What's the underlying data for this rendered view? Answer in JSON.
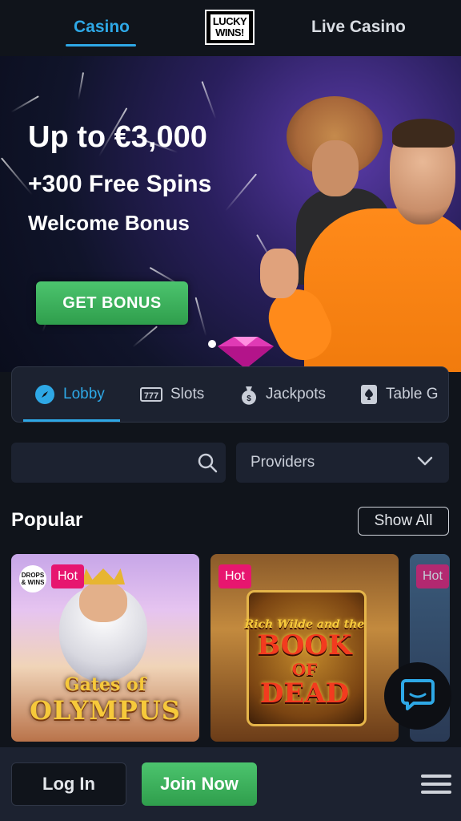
{
  "topnav": {
    "tab_casino": "Casino",
    "tab_live_casino": "Live Casino",
    "logo_line1": "LUCKY",
    "logo_line2": "WINS!"
  },
  "hero": {
    "headline": "Up to €3,000",
    "subline": "+300 Free Spins",
    "tagline": "Welcome Bonus",
    "cta_label": "GET BONUS"
  },
  "categories": [
    {
      "label": "Lobby",
      "icon": "compass-icon",
      "active": true
    },
    {
      "label": "Slots",
      "icon": "slot-777-icon",
      "active": false
    },
    {
      "label": "Jackpots",
      "icon": "money-bag-icon",
      "active": false
    },
    {
      "label": "Table G",
      "icon": "spade-card-icon",
      "active": false
    }
  ],
  "filters": {
    "search_placeholder": "",
    "providers_label": "Providers"
  },
  "popular": {
    "title": "Popular",
    "show_all_label": "Show All",
    "games": [
      {
        "badge": "Hot",
        "provider_badge": "DROPS & WINS",
        "title_line1": "Gates of",
        "title_line2": "OLYMPUS"
      },
      {
        "badge": "Hot",
        "title_line1": "Rich Wilde and the",
        "title_line2": "BOOK",
        "title_line3": "OF",
        "title_line4": "DEAD"
      },
      {
        "badge": "Hot"
      }
    ]
  },
  "bottombar": {
    "login_label": "Log In",
    "join_label": "Join Now"
  },
  "colors": {
    "accent": "#2ea8e6",
    "cta_green": "#3cb05c",
    "hot_badge": "#e7166f",
    "background": "#10141b",
    "panel": "#1c2230"
  }
}
